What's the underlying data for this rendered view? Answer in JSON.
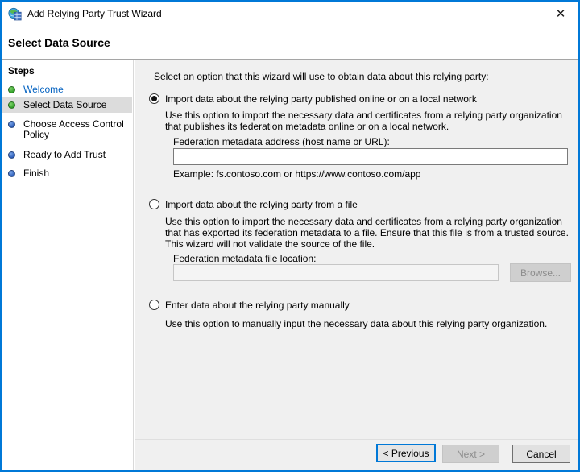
{
  "window": {
    "title": "Add Relying Party Trust Wizard",
    "close_glyph": "✕"
  },
  "header": {
    "title": "Select Data Source"
  },
  "sidebar": {
    "title": "Steps",
    "items": [
      {
        "label": "Welcome",
        "state": "done",
        "current": false
      },
      {
        "label": "Select Data Source",
        "state": "done",
        "current": true
      },
      {
        "label": "Choose Access Control Policy",
        "state": "todo",
        "current": false
      },
      {
        "label": "Ready to Add Trust",
        "state": "todo",
        "current": false
      },
      {
        "label": "Finish",
        "state": "todo",
        "current": false
      }
    ]
  },
  "main": {
    "intro": "Select an option that this wizard will use to obtain data about this relying party:",
    "options": [
      {
        "label": "Import data about the relying party published online or on a local network",
        "selected": true,
        "description": "Use this option to import the necessary data and certificates from a relying party organization that publishes its federation metadata online or on a local network.",
        "field_label": "Federation metadata address (host name or URL):",
        "field_value": "",
        "example": "Example: fs.contoso.com or https://www.contoso.com/app"
      },
      {
        "label": "Import data about the relying party from a file",
        "selected": false,
        "description": "Use this option to import the necessary data and certificates from a relying party organization that has exported its federation metadata to a file. Ensure that this file is from a trusted source.  This wizard will not validate the source of the file.",
        "field_label": "Federation metadata file location:",
        "field_value": "",
        "browse_label": "Browse..."
      },
      {
        "label": "Enter data about the relying party manually",
        "selected": false,
        "description": "Use this option to manually input the necessary data about this relying party organization."
      }
    ]
  },
  "footer": {
    "previous_label": "< Previous",
    "next_label": "Next >",
    "cancel_label": "Cancel"
  },
  "colors": {
    "accent": "#0078d7",
    "window_border": "#0078d7",
    "link_blue": "#0563c1",
    "step_done_green": "#2f9e25",
    "step_todo_blue": "#2b5bb8",
    "selected_step_bg": "#dcdcdc",
    "main_bg": "#f0f0f0",
    "disabled_button_bg": "#cfcfcf"
  }
}
